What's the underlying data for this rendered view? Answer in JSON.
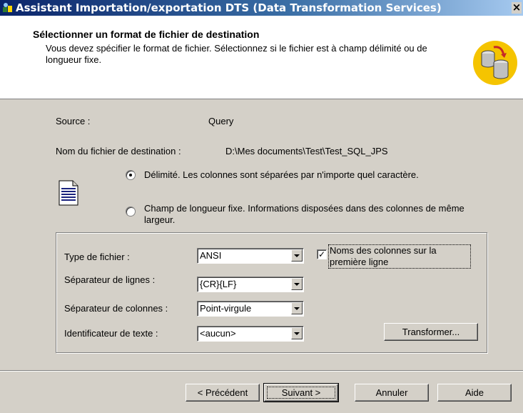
{
  "window": {
    "title": "Assistant Importation/exportation DTS (Data Transformation Services)",
    "close_label": "×"
  },
  "header": {
    "title": "Sélectionner un format de fichier de destination",
    "description": "Vous devez spécifier le format de fichier. Sélectionnez si le fichier est à champ délimité ou de longueur fixe."
  },
  "source": {
    "label": "Source :",
    "value": "Query"
  },
  "destination": {
    "label": "Nom du fichier de destination :",
    "value": "D:\\Mes documents\\Test\\Test_SQL_JPS"
  },
  "format_options": {
    "delimited_label": "Délimité. Les colonnes sont séparées par n'importe quel caractère.",
    "delimited_selected": true,
    "fixed_label": "Champ de longueur fixe. Informations disposées dans des colonnes de même largeur.",
    "fixed_selected": false
  },
  "settings": {
    "file_type_label": "Type de fichier :",
    "file_type_value": "ANSI",
    "row_separator_label": "Séparateur de lignes :",
    "row_separator_value": "{CR}{LF}",
    "column_separator_label": "Séparateur de colonnes :",
    "column_separator_value": "Point-virgule",
    "text_qualifier_label": "Identificateur de texte :",
    "text_qualifier_value": "<aucun>",
    "header_row_label": "Noms des colonnes sur la première ligne",
    "header_row_checked": true,
    "transform_label": "Transformer..."
  },
  "buttons": {
    "back": "< Précédent",
    "next": "Suivant >",
    "cancel": "Annuler",
    "help": "Aide"
  }
}
